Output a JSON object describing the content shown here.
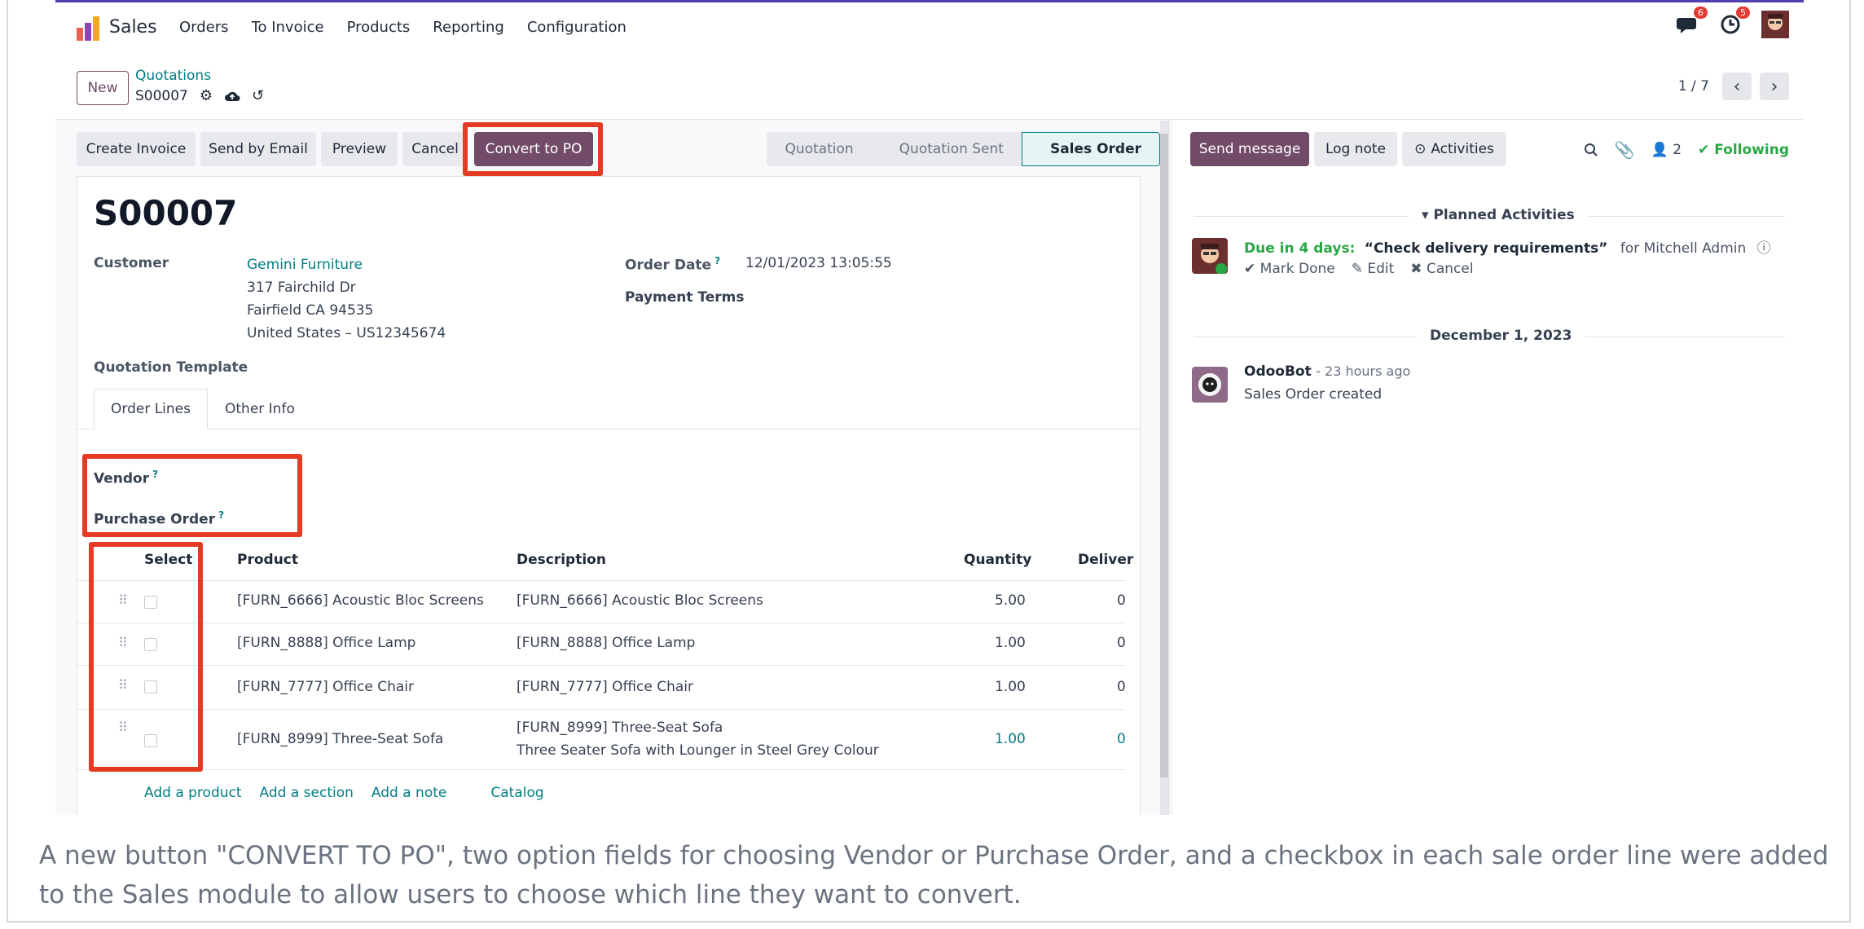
{
  "navbar": {
    "app_name": "Sales",
    "menu": [
      "Orders",
      "To Invoice",
      "Products",
      "Reporting",
      "Configuration"
    ],
    "messages_count": "6",
    "activities_count": "5"
  },
  "control_panel": {
    "new_label": "New",
    "breadcrumb_parent": "Quotations",
    "breadcrumb_current": "S00007",
    "pager_value": "1 / 7"
  },
  "statusbar": {
    "buttons": [
      "Create Invoice",
      "Send by Email",
      "Preview",
      "Cancel",
      "Convert to PO"
    ],
    "stages": [
      "Quotation",
      "Quotation Sent",
      "Sales Order"
    ]
  },
  "form": {
    "name": "S00007",
    "customer_label": "Customer",
    "customer_name": "Gemini Furniture",
    "address_line1": "317 Fairchild Dr",
    "address_line2": "Fairfield CA 94535",
    "address_line3": "United States – US12345674",
    "order_date_label": "Order Date",
    "order_date_value": "12/01/2023 13:05:55",
    "payment_terms_label": "Payment Terms",
    "quotation_template_label": "Quotation Template",
    "help_mark": "?",
    "tabs": [
      "Order Lines",
      "Other Info"
    ],
    "vendor_label": "Vendor",
    "purchase_order_label": "Purchase Order"
  },
  "order_lines": {
    "headers": [
      "Select",
      "Product",
      "Description",
      "Quantity",
      "Deliver"
    ],
    "rows": [
      {
        "product": "[FURN_6666] Acoustic Bloc Screens",
        "description": "[FURN_6666] Acoustic Bloc Screens",
        "description2": "",
        "quantity": "5.00",
        "delivered": "0"
      },
      {
        "product": "[FURN_8888] Office Lamp",
        "description": "[FURN_8888] Office Lamp",
        "description2": "",
        "quantity": "1.00",
        "delivered": "0"
      },
      {
        "product": "[FURN_7777] Office Chair",
        "description": "[FURN_7777] Office Chair",
        "description2": "",
        "quantity": "1.00",
        "delivered": "0"
      },
      {
        "product": "[FURN_8999] Three-Seat Sofa",
        "description": "[FURN_8999] Three-Seat Sofa",
        "description2": "Three Seater Sofa with Lounger in Steel Grey Colour",
        "quantity": "1.00",
        "delivered": "0"
      }
    ],
    "add_links": [
      "Add a product",
      "Add a section",
      "Add a note",
      "Catalog"
    ]
  },
  "chatter": {
    "send_message": "Send message",
    "log_note": "Log note",
    "activities": "Activities",
    "followers_count": "2",
    "following_label": "Following",
    "planned_title": "Planned Activities",
    "activity_due": "Due in 4 days:",
    "activity_summary": "“Check delivery requirements”",
    "activity_for": "for Mitchell Admin",
    "mark_done": "Mark Done",
    "edit": "Edit",
    "cancel": "Cancel",
    "date_separator": "December 1, 2023",
    "msg_author": "OdooBot",
    "msg_time": "- 23 hours ago",
    "msg_body": "Sales Order created"
  },
  "caption": "A new button \"CONVERT TO PO\", two option fields for choosing Vendor or Purchase Order, and a checkbox in each sale order line were added to the Sales module to allow users to choose which line they want to convert.",
  "colors": {
    "brand": "#714b67",
    "link": "#017e84",
    "highlight": "#e53a24",
    "following": "#28a745"
  }
}
